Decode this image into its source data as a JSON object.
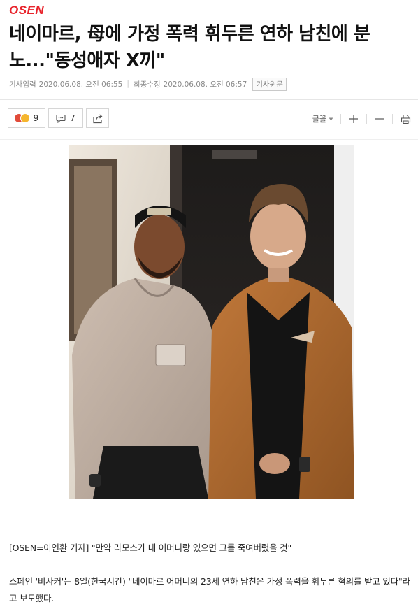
{
  "brand": {
    "logo_text": "OSEN"
  },
  "article": {
    "title": "네이마르, 母에 가정 폭력 휘두른 연하 남친에 분노...\"동성애자 X끼\"",
    "published_label": "기사입력",
    "published_time": "2020.06.08. 오전 06:55",
    "modified_label": "최종수정",
    "modified_time": "2020.06.08. 오전 06:57",
    "source_button": "기사원문",
    "paragraphs": [
      "[OSEN=이인환 기자] \"만약 라모스가 내 어머니랑 있으면 그를 죽여버렸을 것\"",
      "스페인 '비사커'는 8일(한국시간) \"네이마르 어머니의 23세 연하 남친은 가정 폭력을 휘두른 혐의를 받고 있다\"라고 보도했다."
    ]
  },
  "toolbar": {
    "reaction_count": "9",
    "comment_count": "7",
    "font_label": "글꼴"
  },
  "icons": {
    "reaction": "reaction-emoji-icon",
    "comment": "speech-bubble-icon",
    "share": "share-icon",
    "font_dropdown": "chevron-down-icon",
    "increase": "plus-icon",
    "decrease": "minus-icon",
    "print": "print-icon"
  },
  "colors": {
    "brand_red": "#e8242c",
    "meta_gray": "#8a8a8a"
  }
}
